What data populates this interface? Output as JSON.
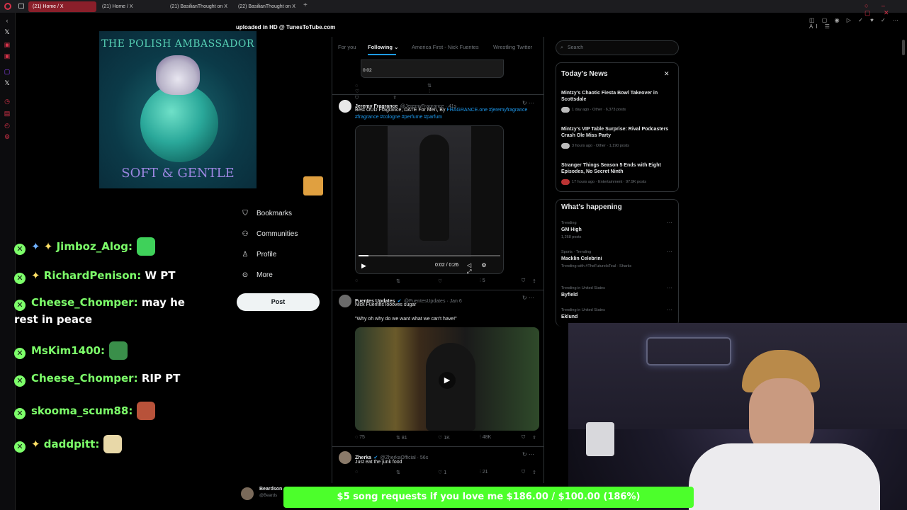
{
  "browser": {
    "tabs": [
      {
        "label": "(21) Home / X",
        "active": true
      },
      {
        "label": "(21) Home / X",
        "active": false
      },
      {
        "label": "(21) BasilianThought on X",
        "active": false
      },
      {
        "label": "(22) BasilianThought on X",
        "active": false
      }
    ]
  },
  "stream": {
    "watermark": "uploaded in HD @ TunesToTube.com",
    "album_title": "THE POLISH AMBASSADOR",
    "album_subtitle": "SOFT & GENTLE",
    "chat": [
      {
        "user": "Jimboz_Alog:",
        "message": "",
        "emote_color": "#3fd15a"
      },
      {
        "user": "RichardPenison:",
        "message": "W PT",
        "emote_color": null
      },
      {
        "user": "Cheese_Chomper:",
        "message": "may he",
        "message2": "rest in peace",
        "emote_color": null
      },
      {
        "user": "MsKim1400:",
        "message": "",
        "emote_color": "#3a8f4a"
      },
      {
        "user": "Cheese_Chomper:",
        "message": "RIP PT",
        "emote_color": null
      },
      {
        "user": "skooma_scum88:",
        "message": "",
        "emote_color": "#b8523a"
      },
      {
        "user": "daddpitt:",
        "message": "",
        "emote_color": "#e8d8a8"
      }
    ],
    "donation_banner": "$5 song requests if you love me $186.00 / $100.00 (186%)"
  },
  "x_nav": {
    "items": [
      {
        "label": "Bookmarks",
        "icon": "bookmark-icon"
      },
      {
        "label": "Communities",
        "icon": "communities-icon"
      },
      {
        "label": "Profile",
        "icon": "profile-icon"
      },
      {
        "label": "More",
        "icon": "more-icon"
      }
    ],
    "post_label": "Post",
    "account_name": "Beardson",
    "account_handle": "@Beards"
  },
  "feed": {
    "tabs": [
      "For you",
      "Following",
      "America First - Nick Fuentes",
      "Wrestling Twitter"
    ],
    "active_tab": "Following",
    "top_video_time": "0:02",
    "tweets": [
      {
        "name": "Jeremy Fragrance",
        "handle": "@JeremyFragrance · 41s",
        "text": "Best OUD Fragrance, DATE For Men, By",
        "link1": "FRAGRANCE.one #jeremyfragrance",
        "link2": "#fragrance #cologne #perfume #parfum",
        "video_time": "0:02 / 0:26",
        "views": "5"
      },
      {
        "name": "Fuentes Updates",
        "handle": "@FuentesUpdates · Jan 6",
        "text": "Nick Fuentes loooves sugar",
        "quote": "\"Why oh why do we want what we can't have!\"",
        "replies": "75",
        "reposts": "81",
        "likes": "1K",
        "views": "48K"
      },
      {
        "name": "Zherka",
        "handle": "@ZherkaOfficial · 56s",
        "text": "Just eat the junk food",
        "likes": "1",
        "views": "21"
      }
    ]
  },
  "right": {
    "search_placeholder": "Search",
    "news_title": "Today's News",
    "news": [
      {
        "headline": "Mintzy's Chaotic Fiesta Bowl Takeover in Scottsdale",
        "meta": "1 day ago · Other · 6,373 posts"
      },
      {
        "headline": "Mintzy's VIP Table Surprise: Rival Podcasters Crash Ole Miss Party",
        "meta": "3 hours ago · Other · 1,190 posts"
      },
      {
        "headline": "Stranger Things Season 5 Ends with Eight Episodes, No Secret Ninth",
        "meta": "17 hours ago · Entertainment · 97.9K posts"
      }
    ],
    "happening_title": "What's happening",
    "trends": [
      {
        "category": "Trending",
        "name": "GM High",
        "count": "1,268 posts"
      },
      {
        "category": "Sports · Trending",
        "name": "Macklin Celebrini",
        "count": "Trending with #TheFutureIsTeal · Sharks"
      },
      {
        "category": "Trending in United States",
        "name": "Byfield",
        "count": ""
      },
      {
        "category": "Trending in United States",
        "name": "Eklund",
        "count": ""
      }
    ]
  }
}
